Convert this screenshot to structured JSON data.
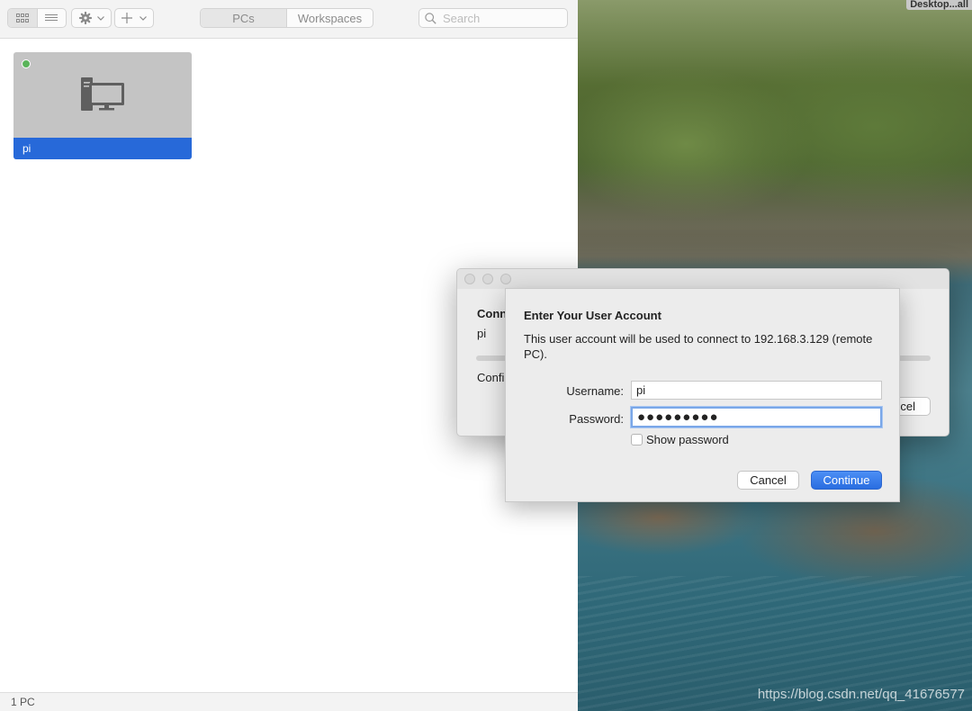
{
  "desktop": {
    "label": "Desktop...all",
    "watermark": "https://blog.csdn.net/qq_41676577"
  },
  "toolbar": {
    "view_icons": [
      "grid-view-icon",
      "list-view-icon"
    ],
    "settings_icon": "gear-icon",
    "add_icon": "plus-icon",
    "tabs": [
      {
        "label": "PCs",
        "active": true
      },
      {
        "label": "Workspaces",
        "active": false
      }
    ],
    "search": {
      "placeholder": "Search",
      "value": ""
    }
  },
  "pcs": [
    {
      "name": "pi",
      "status": "online",
      "status_color": "#5ab45a",
      "selected": true
    }
  ],
  "statusbar": {
    "text": "1 PC"
  },
  "connecting_window": {
    "heading": "Conn",
    "host": "pi",
    "status": "Confi",
    "cancel_label": "cel"
  },
  "credentials_sheet": {
    "title": "Enter Your User Account",
    "message": "This user account will be used to connect to 192.168.3.129 (remote PC).",
    "username_label": "Username:",
    "username_value": "pi",
    "password_label": "Password:",
    "password_masked": "●●●●●●●●●",
    "show_password_label": "Show password",
    "show_password_checked": false,
    "cancel_label": "Cancel",
    "continue_label": "Continue"
  },
  "colors": {
    "accent": "#2769d9",
    "tile_bg": "#c4c4c4",
    "online": "#5ab45a"
  }
}
